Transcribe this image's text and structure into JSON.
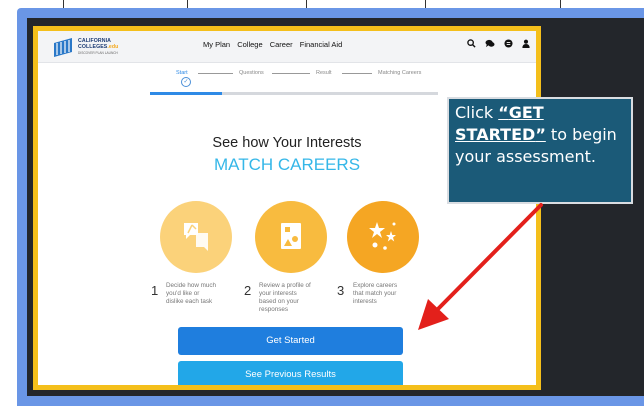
{
  "nav": {
    "logo_line1": "CALIFORNIA",
    "logo_line2": "COLLEGES",
    "logo_line2_suffix": ".edu",
    "logo_tagline": "DISCOVER PLAN LAUNCH",
    "links": [
      "My Plan",
      "College",
      "Career",
      "Financial Aid"
    ],
    "icons": [
      "search-icon",
      "chat-icon",
      "settings-icon",
      "user-icon"
    ]
  },
  "steps": [
    "Start",
    "Questions",
    "Result",
    "Matching Careers"
  ],
  "progress_fraction": 0.25,
  "hero": {
    "line1": "See how Your Interests",
    "line2": "MATCH CAREERS"
  },
  "features": [
    {
      "number": "1",
      "text": [
        "Decide how much",
        "you'd like or",
        "dislike each task"
      ],
      "color": "#fbd27a"
    },
    {
      "number": "2",
      "text": [
        "Review a profile of",
        "your interests",
        "based on your",
        "responses"
      ],
      "color": "#f8bb3f"
    },
    {
      "number": "3",
      "text": [
        "Explore careers",
        "that match your",
        "interests"
      ],
      "color": "#f5a623"
    }
  ],
  "buttons": {
    "get_started": "Get Started",
    "previous_results": "See Previous Results"
  },
  "callout": {
    "prefix": "Click ",
    "highlight_open": "“",
    "highlight": "GET STARTED",
    "highlight_close": "”",
    "suffix": " to begin your assessment."
  },
  "colors": {
    "slide_bg": "#6a96e6",
    "frame": "#f4bf1b",
    "primary_button": "#1f7ede",
    "secondary_button": "#22a7e8",
    "accent_text": "#35b7e8",
    "callout_bg": "#1b5a78",
    "arrow": "#e3201b"
  }
}
